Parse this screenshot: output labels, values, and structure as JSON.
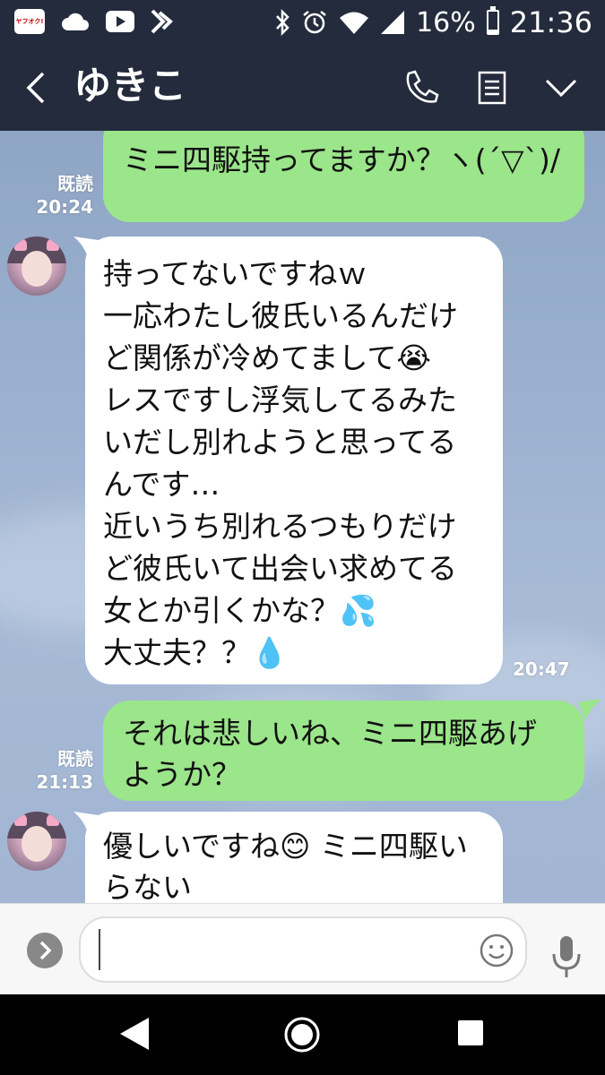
{
  "status_bar": {
    "app_badge": "ヤフオク!",
    "battery_percent": "16%",
    "battery_level": 0.16,
    "time": "21:36"
  },
  "header": {
    "title": "ゆきこ",
    "icons": [
      "back-chevron-icon",
      "phone-icon",
      "notes-icon",
      "chevron-down-icon"
    ]
  },
  "messages": [
    {
      "direction": "out",
      "text": "ミニ四駆持ってますか？ヽ(´▽`)/",
      "read": "既読",
      "time": "20:24"
    },
    {
      "direction": "in",
      "text": "持ってないですねｗ\n一応わたし彼氏いるんだけど関係が冷めてまして😭\nレスですし浮気してるみたいだし別れようと思ってるんです…\n近いうち別れるつもりだけど彼氏いて出会い求めてる女とか引くかな？💦\n大丈夫？？💧",
      "time": "20:47"
    },
    {
      "direction": "out",
      "text": "それは悲しいね、ミニ四駆あげようか？",
      "read": "既読",
      "time": "21:13"
    },
    {
      "direction": "in",
      "text": "優しいですね😊 ミニ四駆いらない",
      "time": ""
    }
  ],
  "input": {
    "placeholder": "",
    "value": ""
  },
  "colors": {
    "header_bg": "#232b3c",
    "out_bubble": "#9be58a",
    "in_bubble": "#ffffff",
    "chat_bg": "#9bb1cf"
  }
}
